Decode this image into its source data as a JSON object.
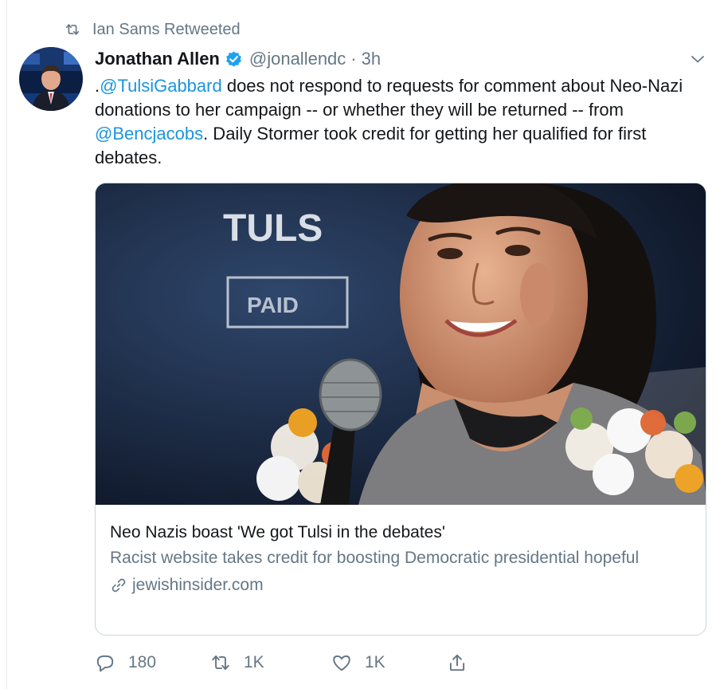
{
  "retweet_context": {
    "text": "Ian Sams Retweeted",
    "icon": "retweet-icon"
  },
  "author": {
    "name": "Jonathan Allen",
    "handle": "@jonallendc",
    "separator": "·",
    "time": "3h",
    "verified": true,
    "verified_color": "#1da1f2"
  },
  "tweet": {
    "segments": [
      {
        "text": ".",
        "type": "text"
      },
      {
        "text": "@TulsiGabbard",
        "type": "mention"
      },
      {
        "text": " does not respond to requests for comment about Neo-Nazi donations to her campaign -- or whether they will be returned -- from ",
        "type": "text"
      },
      {
        "text": "@Bencjacobs",
        "type": "mention"
      },
      {
        "text": ". Daily Stormer took credit for getting her qualified for first debates.",
        "type": "text"
      }
    ]
  },
  "card": {
    "image_sign_text": "TULS",
    "image_badge_text": "PAID",
    "title": "Neo Nazis boast 'We got Tulsi in the debates'",
    "description": "Racist website takes credit for boosting Democratic presidential hopeful",
    "domain": "jewishinsider.com"
  },
  "actions": {
    "reply_count": "180",
    "retweet_count": "1K",
    "like_count": "1K"
  },
  "colors": {
    "link": "#1b95e0",
    "secondary": "#657786",
    "border": "#ccd6dd",
    "text": "#14171a"
  }
}
